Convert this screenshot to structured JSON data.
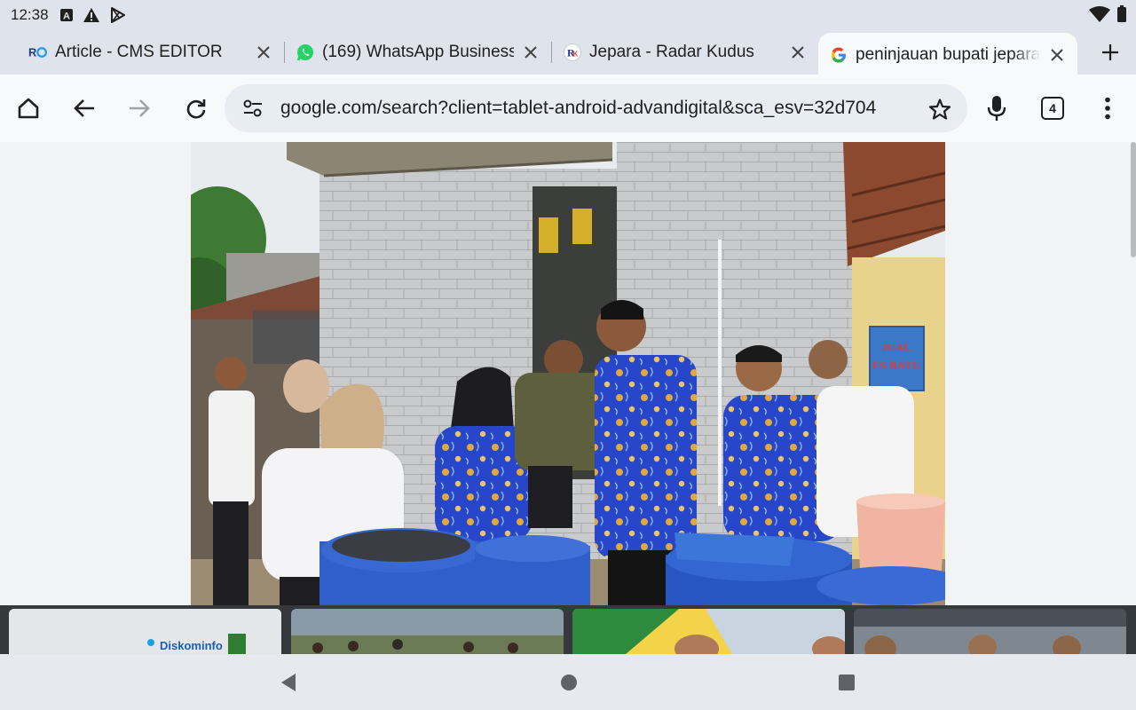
{
  "status": {
    "time": "12:38",
    "left_icons": [
      "text-a-icon",
      "warning-icon",
      "play-store-icon"
    ],
    "right_icons": [
      "wifi-icon",
      "battery-icon"
    ]
  },
  "tabs": [
    {
      "title": "Article - CMS EDITOR",
      "favicon": "ro-logo-icon",
      "active": false
    },
    {
      "title": "(169) WhatsApp Business",
      "favicon": "whatsapp-icon",
      "active": false
    },
    {
      "title": "Jepara - Radar Kudus",
      "favicon": "radar-kudus-icon",
      "active": false
    },
    {
      "title": "peninjauan bupati jepara a",
      "favicon": "google-icon",
      "active": true
    }
  ],
  "toolbar": {
    "url": "google.com/search?client=tablet-android-advandigital&sca_esv=32d704",
    "tab_count": "4"
  },
  "photo": {
    "sign_line1": "JUAL",
    "sign_line2": "ES BATU"
  },
  "thumbnails": {
    "first_logo_text": "Diskominfo"
  },
  "colors": {
    "accent": "#1a73e8",
    "toolbar_bg": "#f8f9fb",
    "tabstrip_bg": "#dfe3eb",
    "omnibox_bg": "#e8ecf3",
    "batik_blue": "#2746c9"
  }
}
